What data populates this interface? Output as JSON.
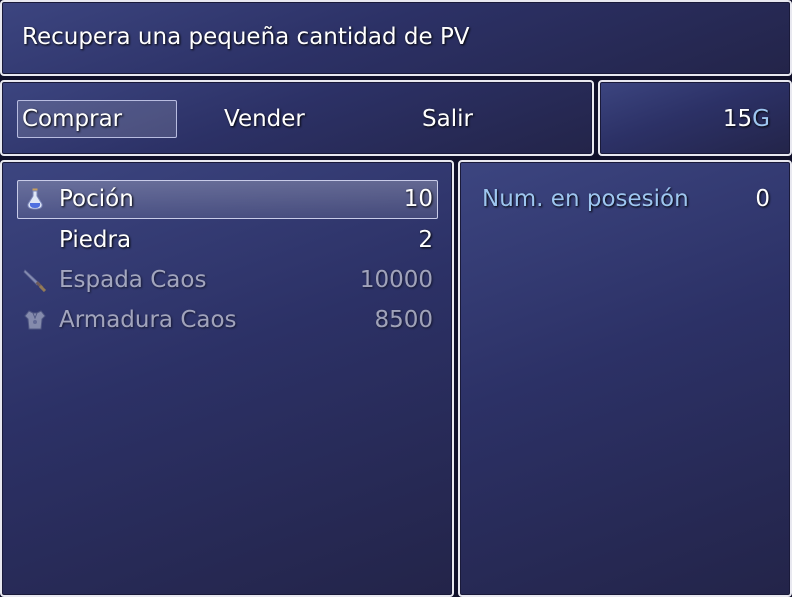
{
  "help": {
    "text": "Recupera una pequeña cantidad de PV"
  },
  "commands": [
    {
      "label": "Comprar",
      "selected": true
    },
    {
      "label": "Vender"
    },
    {
      "label": "Salir"
    }
  ],
  "gold": {
    "amount": "15",
    "unit": "G"
  },
  "items": [
    {
      "name": "Poción",
      "price": "10",
      "icon": "potion-icon",
      "enabled": true,
      "selected": true
    },
    {
      "name": "Piedra",
      "price": "2",
      "icon": "",
      "enabled": true
    },
    {
      "name": "Espada Caos",
      "price": "10000",
      "icon": "sword-icon",
      "enabled": false
    },
    {
      "name": "Armadura Caos",
      "price": "8500",
      "icon": "armor-icon",
      "enabled": false
    }
  ],
  "status": {
    "label": "Num. en posesión",
    "value": "0"
  },
  "colors": {
    "system": "#9ec6f0",
    "window_top": "#3c4580",
    "window_bottom": "#232449"
  }
}
